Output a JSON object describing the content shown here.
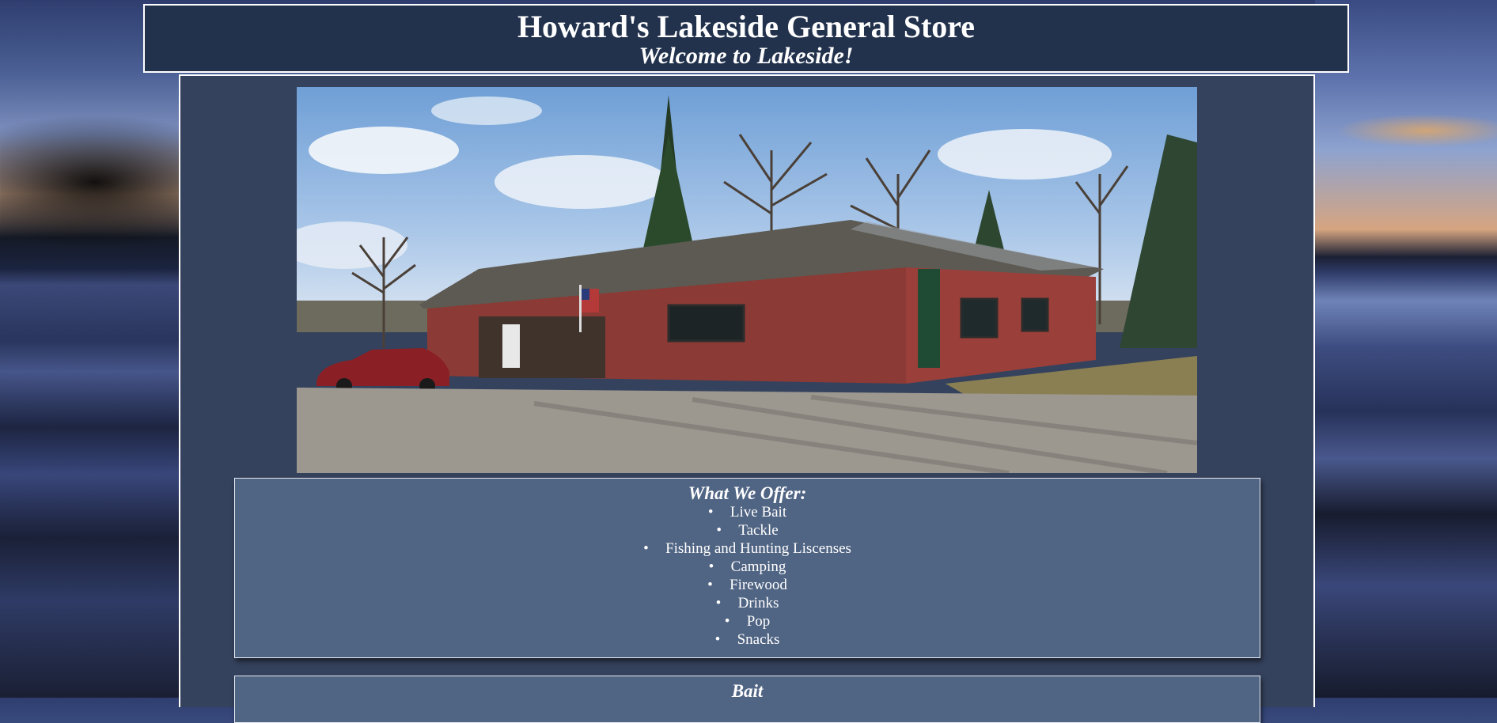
{
  "header": {
    "title": "Howard's Lakeside General Store",
    "subtitle": "Welcome to Lakeside!"
  },
  "offerings": {
    "heading": "What We Offer:",
    "items": [
      "Live Bait",
      "Tackle",
      "Fishing and Hunting Liscenses",
      "Camping",
      "Firewood",
      "Drinks",
      "Pop",
      "Snacks"
    ]
  },
  "bait_section": {
    "heading": "Bait"
  },
  "colors": {
    "header_background": "#22324d",
    "content_background": "#35425d",
    "box_background": "#506483",
    "store_wall": "#8c3a35",
    "text": "#ffffff"
  }
}
